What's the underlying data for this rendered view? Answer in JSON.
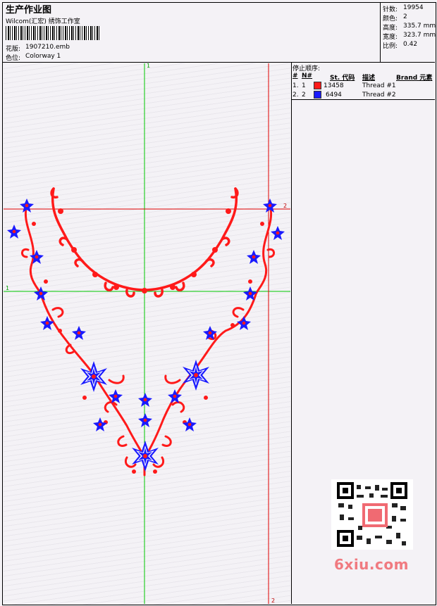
{
  "header": {
    "title": "生产作业图",
    "company": "Wilcom(汇宏) 绣饰工作室",
    "design_label": "花版:",
    "design_value": "1907210.emb",
    "colorway_label": "色位:",
    "colorway_value": "Colorway 1"
  },
  "stats": [
    {
      "label": "针数:",
      "value": "19954"
    },
    {
      "label": "颜色:",
      "value": "2"
    },
    {
      "label": "高度:",
      "value": "335.7 mm"
    },
    {
      "label": "宽度:",
      "value": "323.7 mm"
    },
    {
      "label": "比例:",
      "value": "0.42"
    }
  ],
  "sequence": {
    "title": "停止顺序:",
    "columns": [
      "#",
      "N#",
      "St. 代码",
      "描述",
      "Brand 元素"
    ],
    "rows": [
      {
        "index": "1.",
        "n": "1",
        "color": "#ff1a1a",
        "code": "13458",
        "desc": "Thread #1"
      },
      {
        "index": "2.",
        "n": "2",
        "color": "#1a1aff",
        "code": "6494",
        "desc": "Thread #2"
      }
    ]
  },
  "guides": {
    "top_green": "1",
    "left_green": "1",
    "right_red": "2",
    "bottom_red": "2"
  },
  "watermark": "6xiu.com",
  "colors": {
    "red": "#ff1a1a",
    "blue": "#1a1aff",
    "guide_green": "#00c800",
    "guide_red": "#e00000"
  }
}
